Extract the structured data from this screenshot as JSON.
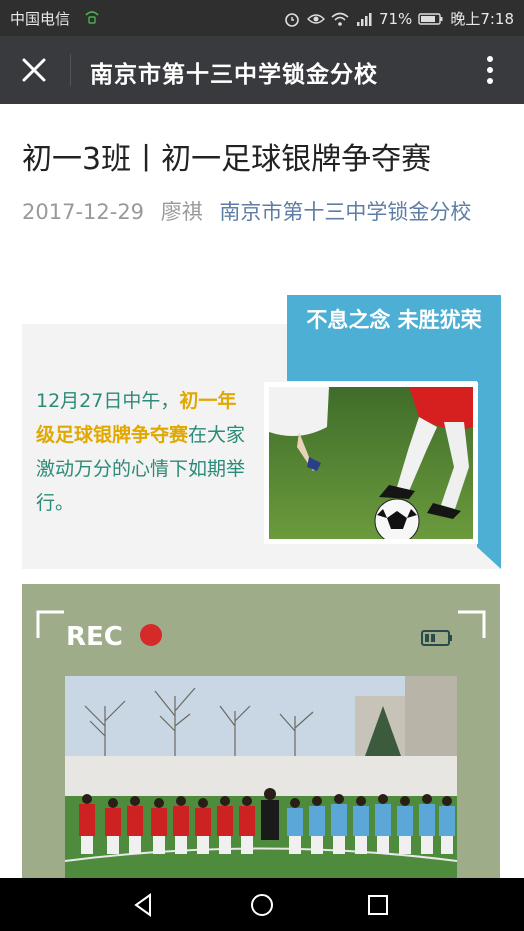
{
  "status": {
    "carrier": "中国电信",
    "battery_percent": "71%",
    "time": "晚上7:18"
  },
  "nav": {
    "title": "南京市第十三中学锁金分校"
  },
  "article": {
    "title": "初一3班丨初一足球银牌争夺赛",
    "date": "2017-12-29",
    "author": "廖祺",
    "account": "南京市第十三中学锁金分校"
  },
  "intro": {
    "slogan": "不息之念 未胜犹荣",
    "text_before": "12月27日中午，",
    "highlight": "初一年级足球银牌争夺赛",
    "text_after": "在大家激动万分的心情下如期举行。"
  },
  "rec": {
    "label": "REC"
  },
  "colors": {
    "accent_blue": "#4dafd4",
    "highlight_gold": "#e1a800",
    "text_teal": "#2c8a78",
    "rec_card_bg": "#9eac8a",
    "rec_dot": "#d42a2a"
  }
}
